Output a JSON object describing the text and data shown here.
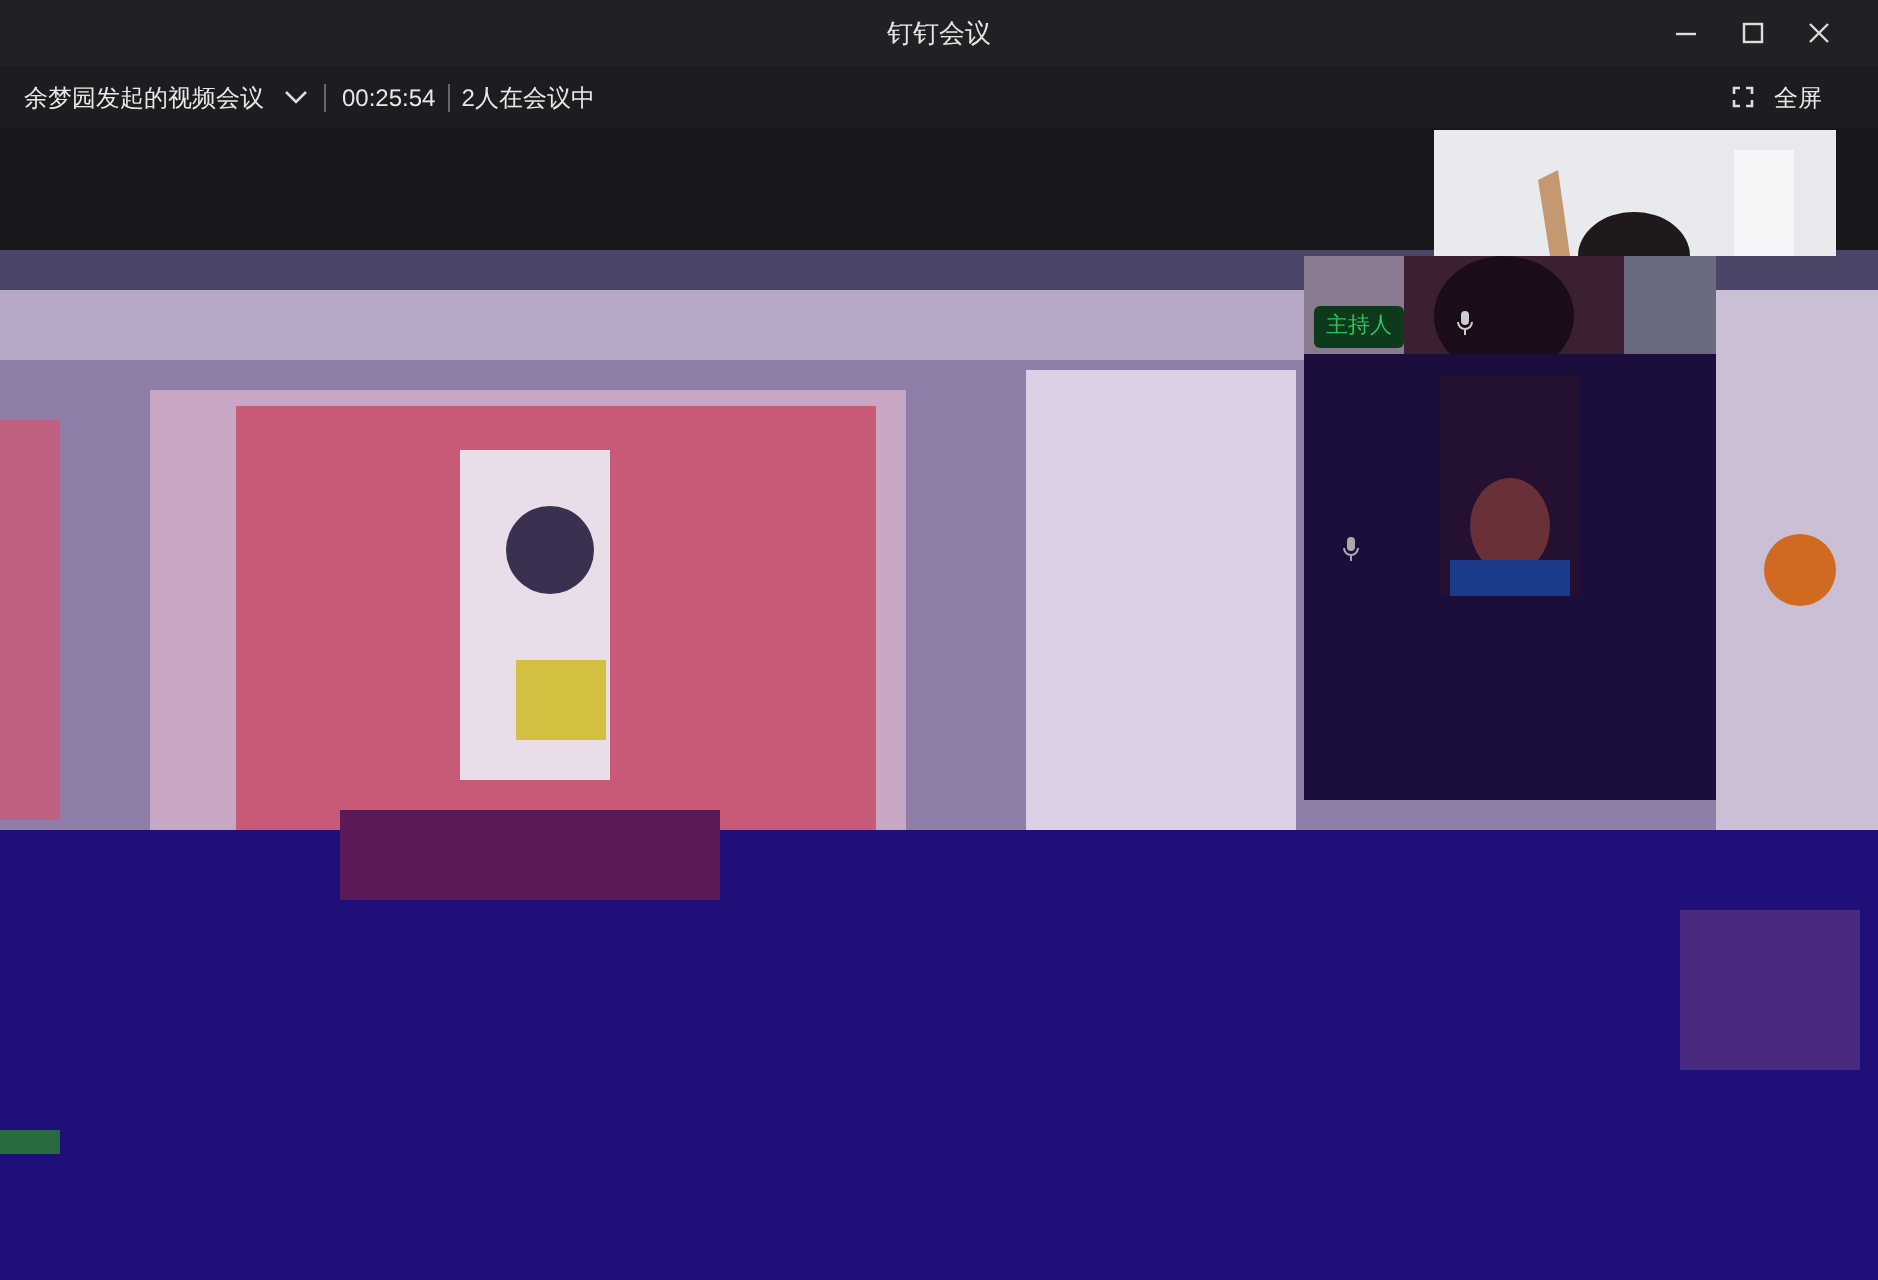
{
  "window": {
    "title": "钉钉会议"
  },
  "meeting": {
    "title": "余梦园发起的视频会议",
    "duration": "00:25:54",
    "participants": "2人在会议中",
    "fullscreen_label": "全屏"
  },
  "host_tile": {
    "badge": "主持人"
  }
}
